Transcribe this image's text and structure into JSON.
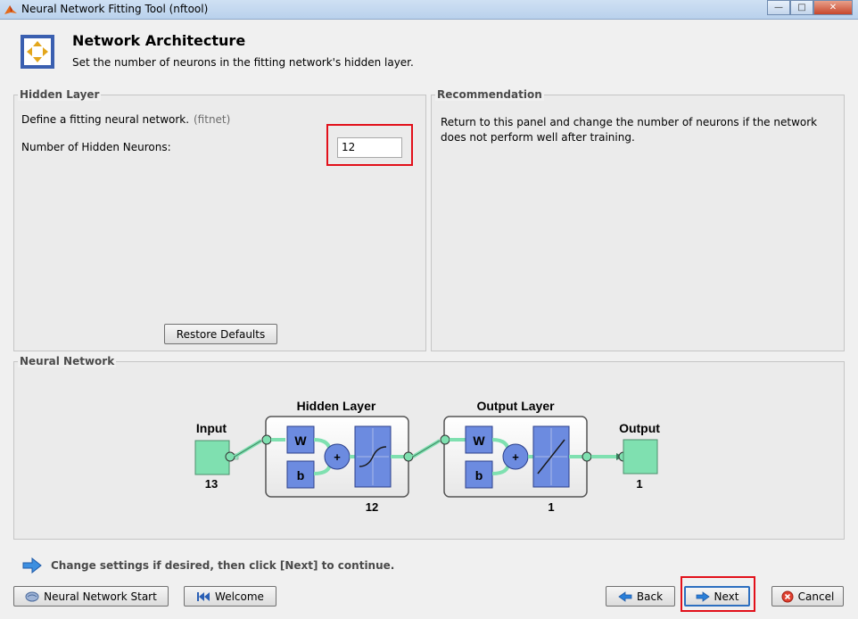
{
  "window": {
    "title": "Neural Network Fitting Tool (nftool)"
  },
  "header": {
    "title": "Network Architecture",
    "subtitle": "Set the number of neurons in the fitting network's hidden layer."
  },
  "hidden_layer_panel": {
    "legend": "Hidden Layer",
    "define_text": "Define a fitting neural network.",
    "define_hint": "(fitnet)",
    "neurons_label": "Number of Hidden Neurons:",
    "neurons_value": "12",
    "restore_button": "Restore Defaults"
  },
  "recommendation_panel": {
    "legend": "Recommendation",
    "text": "Return to this panel and change the number of neurons if the network does not perform well after training."
  },
  "network_panel": {
    "legend": "Neural Network",
    "input_label": "Input",
    "input_size": "13",
    "hidden_label": "Hidden Layer",
    "hidden_size": "12",
    "output_layer_label": "Output Layer",
    "output_layer_size": "1",
    "output_label": "Output",
    "output_size": "1",
    "weight_symbol": "W",
    "bias_symbol": "b",
    "sum_symbol": "+"
  },
  "footer": {
    "hint": "Change settings  if desired, then click [Next] to continue.",
    "nn_start_button": "Neural Network Start",
    "welcome_button": "Welcome",
    "back_button": "Back",
    "next_button": "Next",
    "cancel_button": "Cancel"
  },
  "colors": {
    "highlight": "#e2101a",
    "layer_blue": "#6c8be0",
    "node_green": "#7fe0b0"
  }
}
